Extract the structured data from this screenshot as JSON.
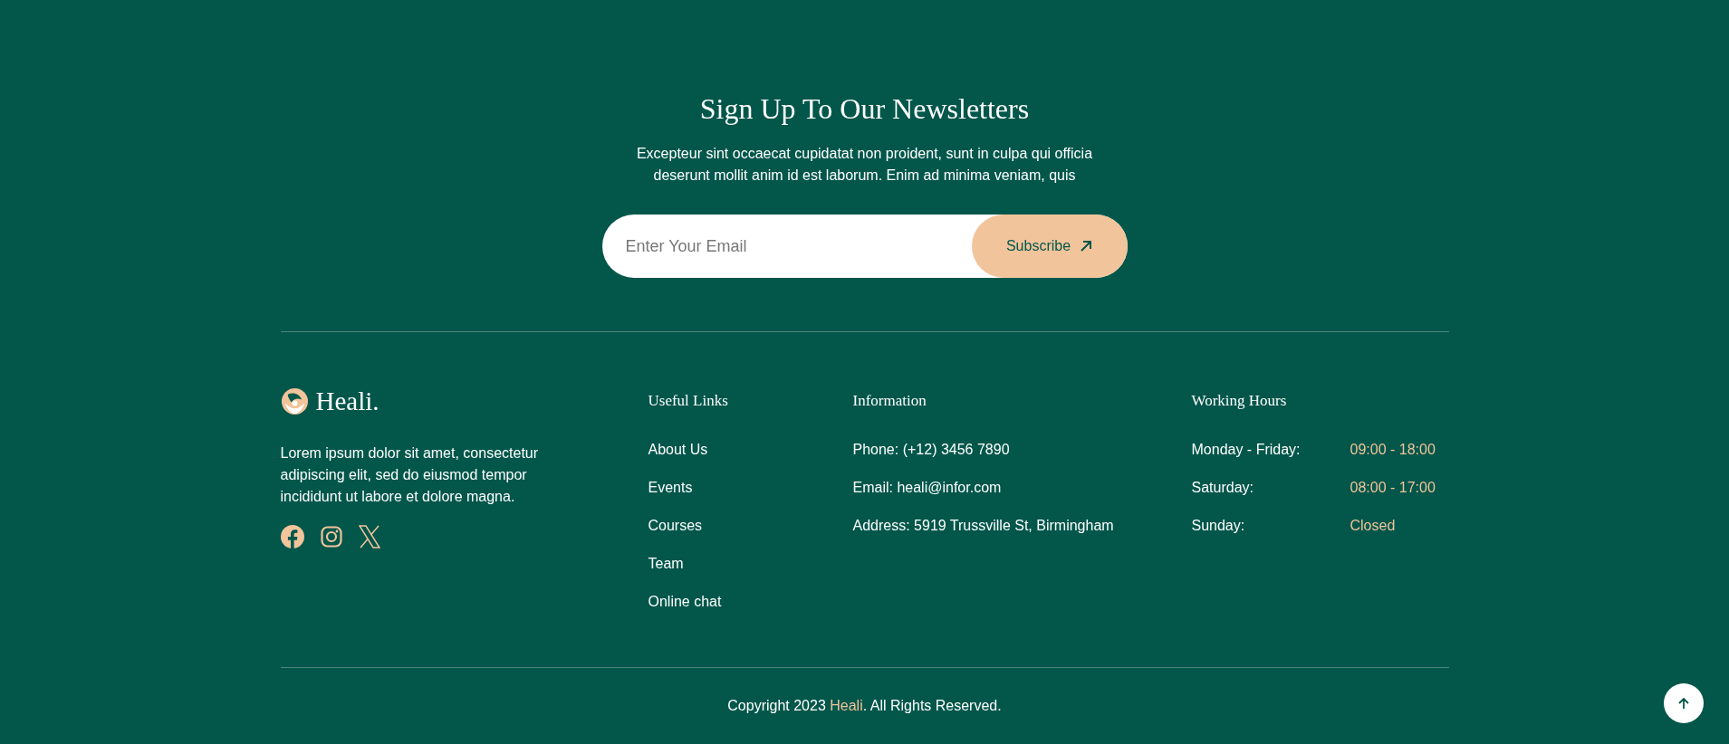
{
  "newsletter": {
    "title": "Sign Up To Our Newsletters",
    "text": "Excepteur sint occaecat cupidatat non proident, sunt in culpa qui officia deserunt mollit anim id est laborum. Enim ad minima veniam, quis",
    "email_placeholder": "Enter Your Email",
    "button": "Subscribe"
  },
  "brand": {
    "name": "Heali.",
    "text": "Lorem ipsum dolor sit amet, consectetur adipiscing elit, sed do eiusmod tempor incididunt ut labore et dolore magna.",
    "socials": [
      {
        "kind": "facebook"
      },
      {
        "kind": "instagram"
      },
      {
        "kind": "x"
      }
    ]
  },
  "useful_links": {
    "title": "Useful Links",
    "items": [
      "About Us",
      "Events",
      "Courses",
      "Team",
      "Online chat"
    ]
  },
  "information": {
    "title": "Information",
    "items": [
      "Phone: (+12) 3456 7890",
      "Email: heali@infor.com",
      "Address: 5919 Trussville St, Birmingham"
    ]
  },
  "working_hours": {
    "title": "Working Hours",
    "rows": [
      {
        "day": "Monday - Friday:",
        "time": "09:00 - 18:00"
      },
      {
        "day": "Saturday:",
        "time": "08:00 - 17:00"
      },
      {
        "day": "Sunday:",
        "time": "Closed"
      }
    ]
  },
  "copyright": {
    "before": "Copyright 2023 ",
    "brand": "Heali",
    "after": ". All Rights Reserved."
  }
}
